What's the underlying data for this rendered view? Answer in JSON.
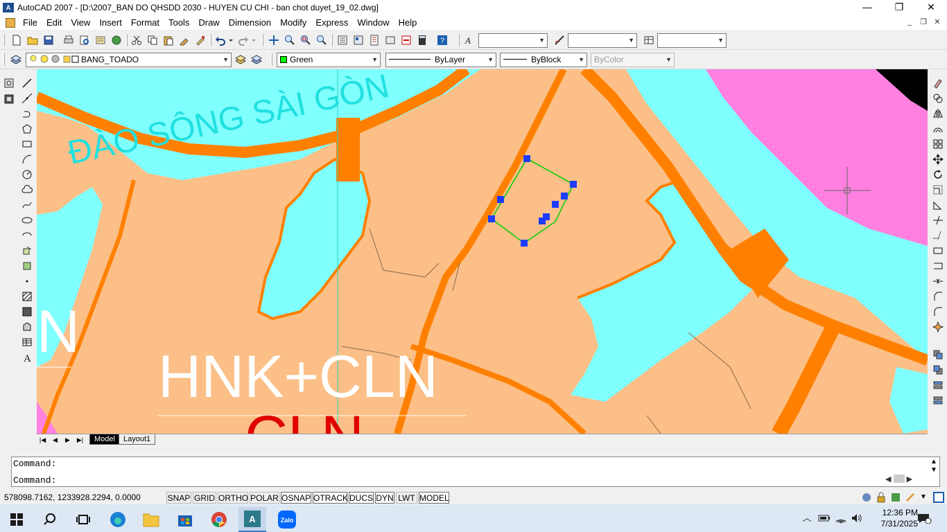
{
  "window": {
    "title": "AutoCAD 2007 - [D:\\2007_BAN DO QHSDD 2030 - HUYEN CU CHI - ban chot duyet_19_02.dwg]",
    "logo": "A",
    "controls": [
      "—",
      "❐",
      "✕"
    ]
  },
  "menu": {
    "items": [
      "File",
      "Edit",
      "View",
      "Insert",
      "Format",
      "Tools",
      "Draw",
      "Dimension",
      "Modify",
      "Express",
      "Window",
      "Help"
    ],
    "doc_controls": [
      "_",
      "❐",
      "✕"
    ]
  },
  "toolbar2": {
    "layer": "BANG_TOADO",
    "color": "Green",
    "color_swatch": "#00ff00",
    "linetype": "ByLayer",
    "lineweight": "ByBlock",
    "plotstyle": "ByColor"
  },
  "drawing": {
    "labels": {
      "river": "ĐÀO SÔNG SÀI GÒN",
      "landuse_main": "HNK+CLN",
      "landuse_red": "CLN",
      "landuse_left": "N"
    },
    "colors": {
      "land": "#fbbf87",
      "water": "#80ffff",
      "road": "#ff8000",
      "pink": "#ff80e0",
      "selection": "#1e3cff"
    }
  },
  "tabs": {
    "active": "Model",
    "items": [
      "Model",
      "Layout1"
    ]
  },
  "command": {
    "line1": "Command:",
    "line2": "Command:"
  },
  "status": {
    "coords": "578098.7162, 1233928.2294, 0.0000",
    "buttons": [
      "SNAP",
      "GRID",
      "ORTHO",
      "POLAR",
      "OSNAP",
      "OTRACK",
      "DUCS",
      "DYN",
      "LWT",
      "MODEL"
    ]
  },
  "taskbar": {
    "time": "12:36 PM",
    "date": "7/31/2025",
    "apps": [
      "start",
      "search",
      "task-view",
      "edge",
      "file-explorer",
      "microsoft-store",
      "chrome",
      "autocad",
      "zalo"
    ],
    "zalo_label": "Zalo"
  }
}
